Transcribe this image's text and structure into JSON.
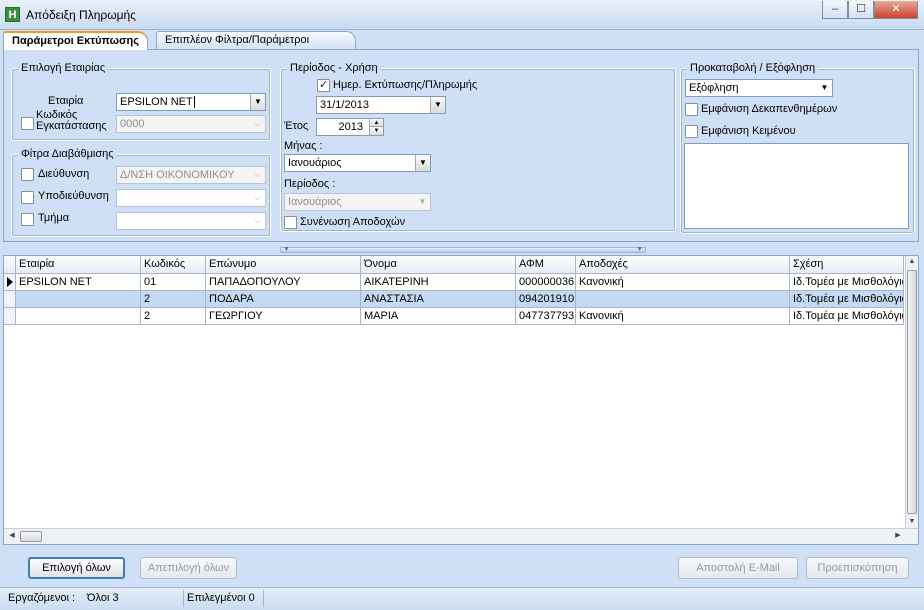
{
  "window": {
    "title": "Απόδειξη Πληρωμής",
    "app_icon_letter": "H",
    "minimize": "‒",
    "maximize": "☐",
    "close": "✕"
  },
  "tabs": [
    {
      "label": "Παράμετροι Εκτύπωσης",
      "active": true
    },
    {
      "label": "Επιπλέον Φίλτρα/Παράμετροι",
      "active": false
    }
  ],
  "company_group": {
    "title": "Επιλογή Εταιρίας",
    "company_label": "Εταιρία",
    "company_value": "EPSILON NET",
    "install_code_label_line1": "Κωδικός",
    "install_code_label_line2": "Εγκατάστασης",
    "install_code_value": "0000"
  },
  "hierarchy_group": {
    "title": "Φίτρα Διαβάθμισης",
    "direction_label": "Διεύθυνση",
    "direction_value": "Δ/ΝΣΗ ΟΙΚΟΝΟΜΙΚΟΥ",
    "subdirection_label": "Υποδιεύθυνση",
    "subdirection_value": "",
    "section_label": "Τμήμα",
    "section_value": ""
  },
  "period_group": {
    "title": "Περίοδος - Χρήση",
    "print_date_label": "Ημερ. Εκτύπωσης/Πληρωμής",
    "print_date_checked": true,
    "print_date_value": "31/1/2013",
    "year_label": "Έτος",
    "year_value": "2013",
    "month_label": "Μήνας :",
    "month_value": "Ιανουάριος",
    "period_label": "Περίοδος :",
    "period_value": "Ιανουάριος",
    "merge_earnings_label": "Συνένωση Αποδοχών",
    "merge_earnings_checked": false
  },
  "advance_group": {
    "title": "Προκαταβολή / Εξόφληση",
    "type_value": "Εξόφληση",
    "show_fortnight_label": "Εμφάνιση Δεκαπενθημέρων",
    "show_text_label": "Εμφάνιση Κειμένου"
  },
  "grid": {
    "columns": [
      "Εταιρία",
      "Κωδικός",
      "Επώνυμο",
      "Όνομα",
      "ΑΦΜ",
      "Αποδοχές",
      "Σχέση"
    ],
    "rows": [
      {
        "company": "EPSILON NET",
        "code": "01",
        "surname": "ΠΑΠΑΔΟΠΟΥΛΟΥ",
        "name": "ΑΙΚΑΤΕΡΙΝΗ",
        "afm": "000000036",
        "earnings": "Κανονική",
        "relation": "Ιδ.Τομέα με Μισθολόγιο",
        "current": true
      },
      {
        "company": "",
        "code": "2",
        "surname": "ΠΟΔΑΡΑ",
        "name": "ΑΝΑΣΤΑΣΙΑ",
        "afm": "094201910",
        "earnings": "",
        "relation": "Ιδ.Τομέα με Μισθολόγιο",
        "current": false
      },
      {
        "company": "",
        "code": "2",
        "surname": "ΓΕΩΡΓΙΟΥ",
        "name": "ΜΑΡΙΑ",
        "afm": "047737793",
        "earnings": "Κανονική",
        "relation": "Ιδ.Τομέα με Μισθολόγιο",
        "current": false
      }
    ]
  },
  "buttons": {
    "select_all": "Επιλογή όλων",
    "deselect_all": "Απεπιλογή όλων",
    "send_email": "Αποστολή E-Mail",
    "preview": "Προεπισκόπηση"
  },
  "status": {
    "employees_label": "Εργαζόμενοι :",
    "all_label": "Όλοι 3",
    "selected_label": "Επιλεγμένοι 0"
  }
}
